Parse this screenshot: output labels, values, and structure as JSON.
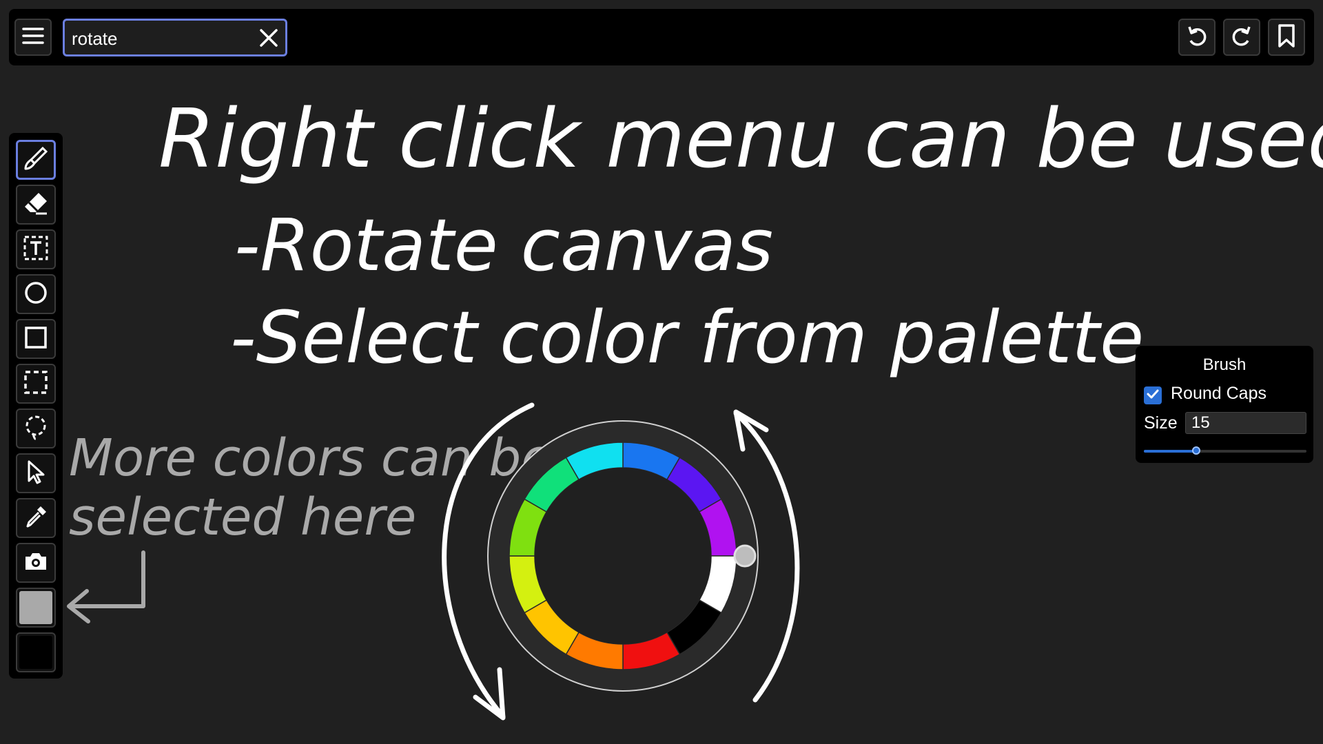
{
  "top_bar": {
    "menu_icon": "hamburger-menu-icon",
    "search": {
      "value": "rotate",
      "clear_icon": "close-icon"
    },
    "actions": [
      {
        "name": "undo-button",
        "icon": "undo-icon"
      },
      {
        "name": "redo-button",
        "icon": "redo-icon"
      },
      {
        "name": "bookmark-button",
        "icon": "bookmark-icon"
      }
    ]
  },
  "toolbar": {
    "tools": [
      {
        "name": "brush-tool",
        "icon": "brush-icon",
        "active": true
      },
      {
        "name": "eraser-tool",
        "icon": "eraser-icon"
      },
      {
        "name": "text-tool",
        "icon": "text-box-icon"
      },
      {
        "name": "ellipse-tool",
        "icon": "circle-icon"
      },
      {
        "name": "rectangle-tool",
        "icon": "square-icon"
      },
      {
        "name": "rect-select-tool",
        "icon": "dashed-square-icon"
      },
      {
        "name": "lasso-select-tool",
        "icon": "lasso-icon"
      },
      {
        "name": "pointer-tool",
        "icon": "cursor-arrow-icon"
      },
      {
        "name": "eyedropper-tool",
        "icon": "eyedropper-icon"
      },
      {
        "name": "screenshot-tool",
        "icon": "camera-icon"
      }
    ],
    "primary_color": "#a9a9a9",
    "secondary_color": "#000000"
  },
  "canvas": {
    "heading": "Right click menu can be used to:",
    "bullet_1": "-Rotate canvas",
    "bullet_2": "-Select color from palette",
    "note_line_1": "More colors can be",
    "note_line_2": "selected here",
    "ink_color": "#ffffff",
    "note_color": "#a9a9a9"
  },
  "color_ring": {
    "segments": [
      "#1976f0",
      "#5b16f2",
      "#b012f0",
      "#ffffff",
      "#000000",
      "#f01010",
      "#ff7a00",
      "#ffc400",
      "#d4f010",
      "#7fe010",
      "#10e07a",
      "#10e0f0"
    ]
  },
  "brush_panel": {
    "title": "Brush",
    "round_caps_label": "Round Caps",
    "round_caps_checked": true,
    "size_label": "Size",
    "size_value": "15",
    "size_slider_fraction": 0.32,
    "accent_color": "#2a6fd6"
  }
}
